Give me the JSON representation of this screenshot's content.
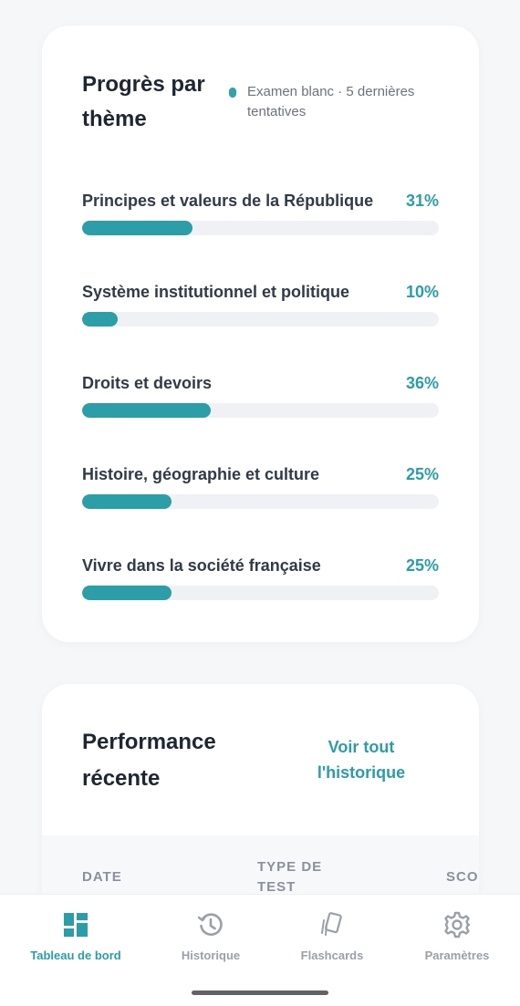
{
  "progress": {
    "title": "Progrès par thème",
    "legend": "Examen blanc · 5 dernières tentatives",
    "accent_color": "#2c9ea8",
    "themes": [
      {
        "label": "Principes et valeurs de la République",
        "percent_label": "31%",
        "percent": 31
      },
      {
        "label": "Système institutionnel et politique",
        "percent_label": "10%",
        "percent": 10
      },
      {
        "label": "Droits et devoirs",
        "percent_label": "36%",
        "percent": 36
      },
      {
        "label": "Histoire, géographie et culture",
        "percent_label": "25%",
        "percent": 25
      },
      {
        "label": "Vivre dans la société française",
        "percent_label": "25%",
        "percent": 25
      }
    ]
  },
  "performance": {
    "title": "Performance récente",
    "history_link": "Voir tout l'historique",
    "columns": [
      "DATE",
      "TYPE DE TEST",
      "SCO"
    ]
  },
  "nav": {
    "items": [
      {
        "label": "Tableau de bord",
        "icon": "dashboard-icon",
        "active": true
      },
      {
        "label": "Historique",
        "icon": "history-icon",
        "active": false
      },
      {
        "label": "Flashcards",
        "icon": "flashcards-icon",
        "active": false
      },
      {
        "label": "Paramètres",
        "icon": "gear-icon",
        "active": false
      }
    ]
  }
}
